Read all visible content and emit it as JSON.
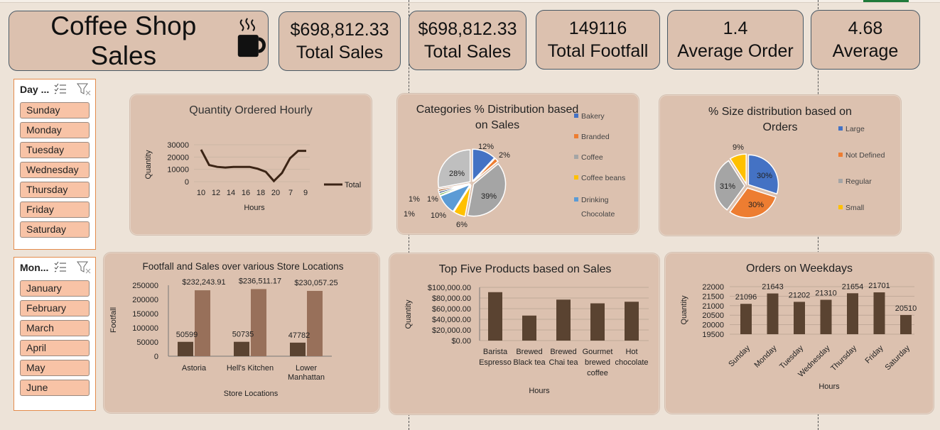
{
  "header": {
    "title": "Coffee Shop Sales",
    "icon": "coffee-cup-icon"
  },
  "kpis": [
    {
      "value": "$698,812.33",
      "label": "Total Sales"
    },
    {
      "value": "$698,812.33",
      "label": "Total Sales"
    },
    {
      "value": "149116",
      "label": "Total Footfall"
    },
    {
      "value": "1.4",
      "label": "Average Order"
    },
    {
      "value": "4.68",
      "label": "Average"
    }
  ],
  "slicers": {
    "day": {
      "title": "Day ...",
      "items": [
        "Sunday",
        "Monday",
        "Tuesday",
        "Wednesday",
        "Thursday",
        "Friday",
        "Saturday"
      ]
    },
    "month": {
      "title": "Mon...",
      "items": [
        "January",
        "February",
        "March",
        "April",
        "May",
        "June"
      ]
    }
  },
  "colors": {
    "panel": "#dcc1af",
    "dark_bar": "#5a4331",
    "light_bar": "#98705a",
    "slicer_item": "#f8c3a6",
    "line": "#3b2415"
  },
  "chart_data": [
    {
      "type": "line",
      "title": "Quantity Ordered Hourly",
      "xlabel": "Hours",
      "ylabel": "Quantity",
      "x_ticks": [
        "10",
        "12",
        "14",
        "16",
        "18",
        "20",
        "7",
        "9"
      ],
      "y_ticks": [
        "30000",
        "20000",
        "10000",
        "0"
      ],
      "ylim": [
        0,
        30000
      ],
      "series": [
        {
          "name": "Total",
          "values": [
            26000,
            13500,
            12000,
            11500,
            12000,
            12000,
            12000,
            10500,
            8000,
            500,
            7000,
            19000,
            25000,
            25000
          ]
        }
      ],
      "legend": "right"
    },
    {
      "type": "pie",
      "title": "Categories % Distribution based on Sales",
      "legend": [
        "Bakery",
        "Branded",
        "Coffee",
        "Coffee beans",
        "Drinking Chocolate"
      ],
      "slices": [
        {
          "label": "12%",
          "value": 12,
          "color": "#4472c4"
        },
        {
          "label": "2%",
          "value": 2,
          "color": "#ed7d31"
        },
        {
          "label": "39%",
          "value": 39,
          "color": "#a5a5a5"
        },
        {
          "label": "6%",
          "value": 6,
          "color": "#ffc000"
        },
        {
          "label": "10%",
          "value": 10,
          "color": "#5b9bd5"
        },
        {
          "label": "1%",
          "value": 1,
          "color": "#70ad47"
        },
        {
          "label": "1%",
          "value": 1,
          "color": "#264478"
        },
        {
          "label": "1%",
          "value": 1,
          "color": "#9e480e"
        },
        {
          "label": "28%",
          "value": 28,
          "color": "#bfbfbf"
        }
      ]
    },
    {
      "type": "pie",
      "title": "% Size distribution based on Orders",
      "legend": [
        "Large",
        "Not Defined",
        "Regular",
        "Small"
      ],
      "slices": [
        {
          "label": "30%",
          "value": 30,
          "color": "#4472c4"
        },
        {
          "label": "30%",
          "value": 30,
          "color": "#ed7d31"
        },
        {
          "label": "31%",
          "value": 31,
          "color": "#a5a5a5"
        },
        {
          "label": "9%",
          "value": 9,
          "color": "#ffc000"
        }
      ]
    },
    {
      "type": "bar",
      "title": "Footfall and Sales over various Store Locations",
      "xlabel": "Store Locations",
      "ylabel": "Footfall",
      "categories": [
        "Astoria",
        "Hell's Kitchen",
        "Lower Manhattan"
      ],
      "y_ticks": [
        "250000",
        "200000",
        "150000",
        "100000",
        "50000",
        "0"
      ],
      "ylim": [
        0,
        250000
      ],
      "series": [
        {
          "values": [
            50599,
            50735,
            47782
          ],
          "labels": [
            "50599",
            "50735",
            "47782"
          ]
        },
        {
          "values": [
            232243.91,
            236511.17,
            230057.25
          ],
          "labels": [
            "$232,243.91",
            "$236,511.17",
            "$230,057.25"
          ]
        }
      ]
    },
    {
      "type": "bar",
      "title": "Top Five Products based on Sales",
      "xlabel": "Hours",
      "ylabel": "Quantity",
      "categories": [
        "Barista Espresso",
        "Brewed Black tea",
        "Brewed Chai tea",
        "Gourmet brewed coffee",
        "Hot chocolate"
      ],
      "y_ticks": [
        "$100,000.00",
        "$80,000.00",
        "$60,000.00",
        "$40,000.00",
        "$20,000.00",
        "$0.00"
      ],
      "ylim": [
        0,
        100000
      ],
      "values": [
        91000,
        47000,
        77000,
        70000,
        73000
      ]
    },
    {
      "type": "bar",
      "title": "Orders on Weekdays",
      "xlabel": "Hours",
      "ylabel": "Quantity",
      "categories": [
        "Sunday",
        "Monday",
        "Tuesday",
        "Wednesday",
        "Thursday",
        "Friday",
        "Saturday"
      ],
      "y_ticks": [
        "22000",
        "21500",
        "21000",
        "20500",
        "20000",
        "19500"
      ],
      "ylim": [
        19500,
        22000
      ],
      "values": [
        21096,
        21643,
        21202,
        21310,
        21654,
        21701,
        20510
      ],
      "labels": [
        "21096",
        "21643",
        "21202",
        "21310",
        "21654",
        "21701",
        "20510"
      ]
    }
  ]
}
